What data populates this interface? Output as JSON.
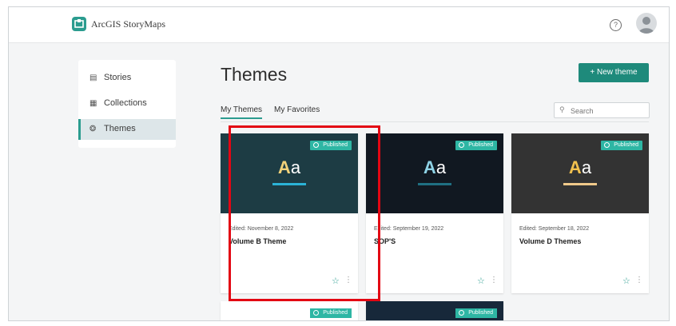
{
  "app": {
    "title": "ArcGIS StoryMaps"
  },
  "header": {
    "help_icon": "help-icon",
    "avatar_icon": "avatar-icon",
    "help_glyph": "?"
  },
  "sidebar": {
    "items": [
      {
        "label": "Stories",
        "icon": "stories-icon",
        "glyph": "▤",
        "active": false
      },
      {
        "label": "Collections",
        "icon": "collections-icon",
        "glyph": "▦",
        "active": false
      },
      {
        "label": "Themes",
        "icon": "themes-icon",
        "glyph": "❂",
        "active": true
      }
    ]
  },
  "main": {
    "title": "Themes",
    "new_button": "+ New theme",
    "tabs": [
      {
        "label": "My Themes",
        "active": true
      },
      {
        "label": "My Favorites",
        "active": false
      }
    ],
    "search": {
      "placeholder": "Search",
      "glyph": "⚲"
    }
  },
  "cards": [
    {
      "badge": "Published",
      "aa_big": "A",
      "aa_small": "a",
      "edited": "Edited: November 8, 2022",
      "title": "Volume B Theme",
      "star": "☆",
      "kebab": "⋮"
    },
    {
      "badge": "Published",
      "aa_big": "A",
      "aa_small": "a",
      "edited": "Edited: September 19, 2022",
      "title": "SOP'S",
      "star": "☆",
      "kebab": "⋮"
    },
    {
      "badge": "Published",
      "aa_big": "A",
      "aa_small": "a",
      "edited": "Edited: September 18, 2022",
      "title": "Volume D Themes",
      "star": "☆",
      "kebab": "⋮"
    }
  ],
  "partial_cards": [
    {
      "badge": "Published"
    },
    {
      "badge": "Published"
    }
  ],
  "colors": {
    "accent": "#1e8a7b",
    "badge": "#2eb6a4",
    "card1_bg": "#1d3c44",
    "card1_bar": "#2bb3d6",
    "card2_bg": "#111821",
    "card2_bar": "#1f6f82",
    "card3_bg": "#333333",
    "card3_bar": "#f0c98a",
    "highlight": "#e30613"
  }
}
